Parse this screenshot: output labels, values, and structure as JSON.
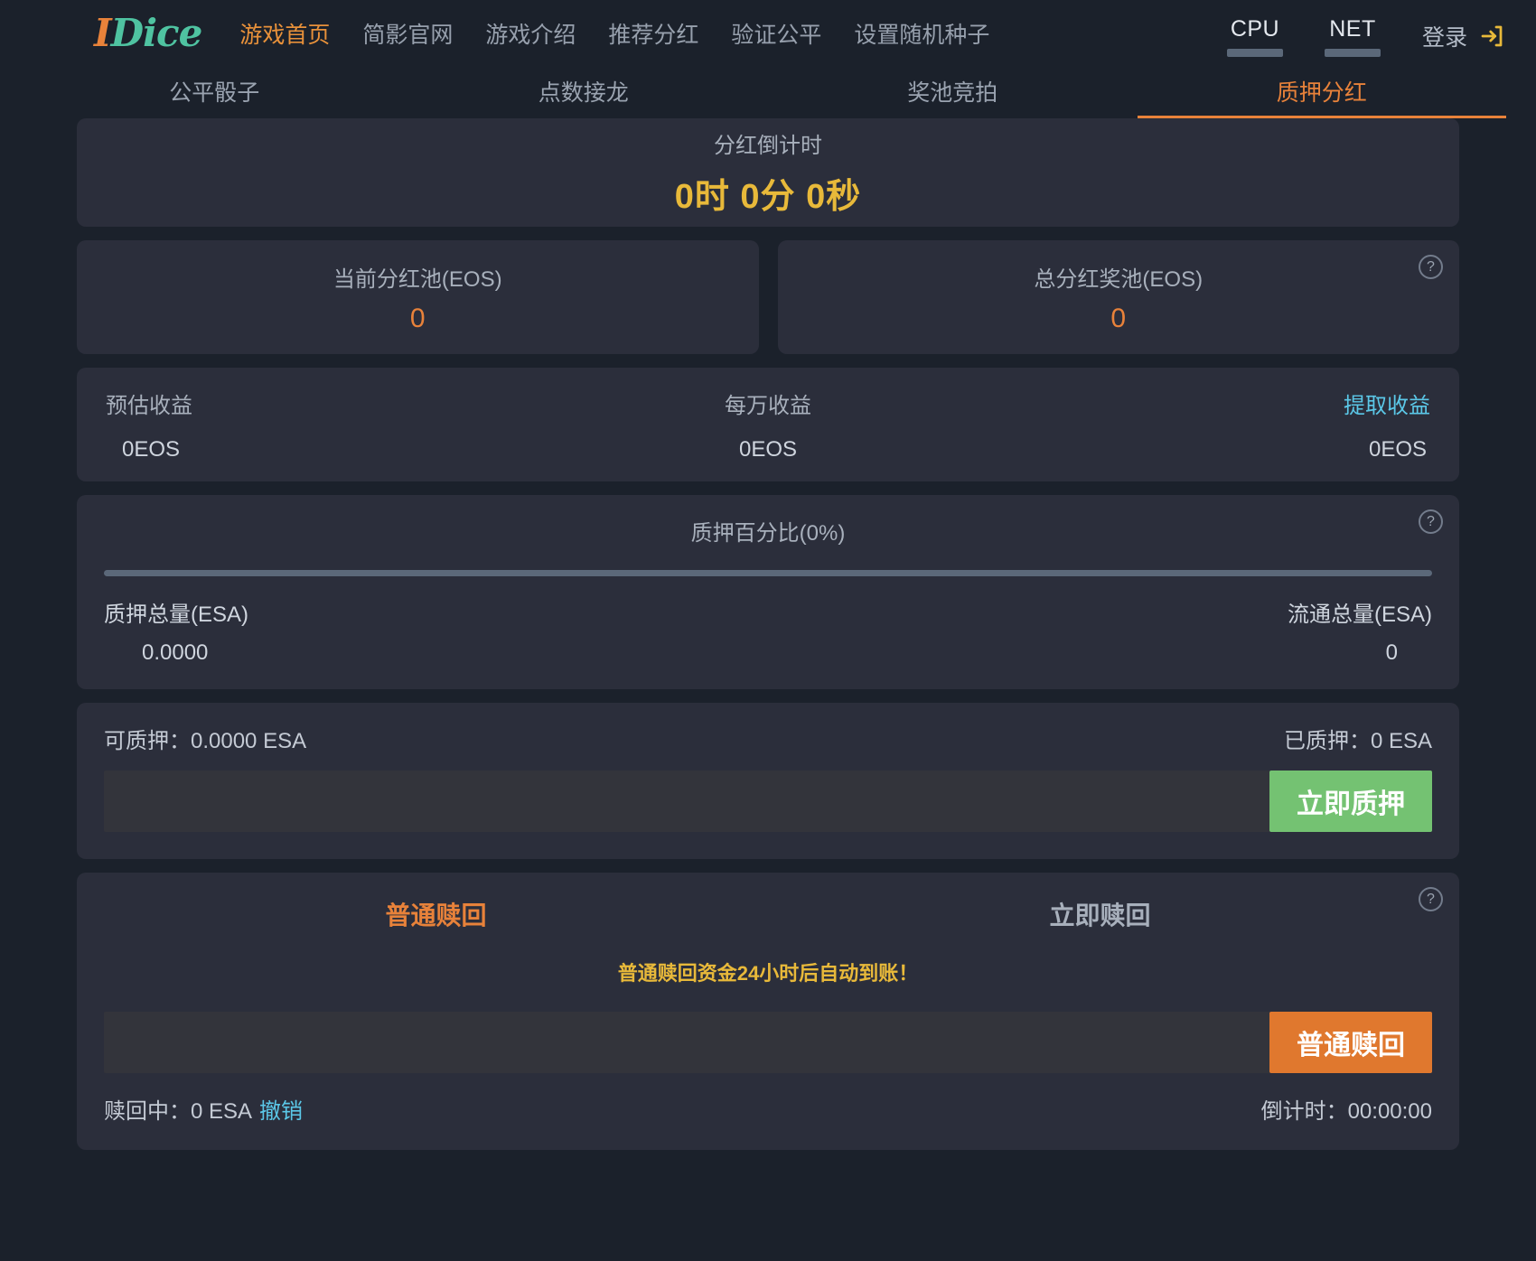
{
  "brand": {
    "prefix": "I",
    "rest": "Dice"
  },
  "nav": {
    "links": [
      {
        "label": "游戏首页",
        "active": true
      },
      {
        "label": "简影官网",
        "active": false
      },
      {
        "label": "游戏介绍",
        "active": false
      },
      {
        "label": "推荐分红",
        "active": false
      },
      {
        "label": "验证公平",
        "active": false
      },
      {
        "label": "设置随机种子",
        "active": false
      }
    ],
    "resources": [
      {
        "label": "CPU"
      },
      {
        "label": "NET"
      }
    ],
    "login_label": "登录",
    "login_icon": "sign-in-icon"
  },
  "subtabs": [
    {
      "label": "公平骰子",
      "active": false
    },
    {
      "label": "点数接龙",
      "active": false
    },
    {
      "label": "奖池竞拍",
      "active": false
    },
    {
      "label": "质押分红",
      "active": true
    }
  ],
  "countdown": {
    "title": "分红倒计时",
    "value": "0时 0分 0秒"
  },
  "pools": [
    {
      "title": "当前分红池(EOS)",
      "value": "0",
      "help": false
    },
    {
      "title": "总分红奖池(EOS)",
      "value": "0",
      "help": true
    }
  ],
  "earnings": {
    "estimated_label": "预估收益",
    "estimated_value": "0EOS",
    "per_ten_thousand_label": "每万收益",
    "per_ten_thousand_value": "0EOS",
    "withdraw_label": "提取收益",
    "withdraw_value": "0EOS"
  },
  "stake_percent": {
    "title": "质押百分比(0%)",
    "percent": 0,
    "total_staked_label": "质押总量(ESA)",
    "total_staked_value": "0.0000",
    "circulating_label": "流通总量(ESA)",
    "circulating_value": "0",
    "help": true
  },
  "stake": {
    "available_label": "可质押：0.0000 ESA",
    "staked_label": "已质押：0 ESA",
    "input_value": "",
    "input_placeholder": "",
    "button_label": "立即质押"
  },
  "redeem": {
    "tabs": [
      {
        "label": "普通赎回",
        "active": true
      },
      {
        "label": "立即赎回",
        "active": false
      }
    ],
    "note": "普通赎回资金24小时后自动到账！",
    "input_value": "",
    "input_placeholder": "",
    "button_label": "普通赎回",
    "pending_label": "赎回中：0 ESA",
    "cancel_label": "撤销",
    "countdown_label": "倒计时：00:00:00",
    "help": true
  },
  "colors": {
    "page_bg": "#1b212b",
    "card_bg": "#2b2e3b",
    "accent_orange": "#e8823a",
    "accent_green": "#74c272",
    "accent_yellow": "#e8b93a",
    "accent_cyan": "#5bc8e8",
    "logo_teal": "#4fc3a1"
  }
}
